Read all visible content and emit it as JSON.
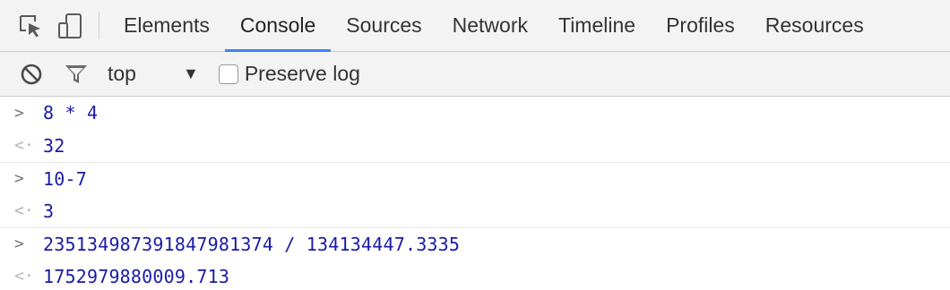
{
  "tabs": [
    {
      "label": "Elements"
    },
    {
      "label": "Console",
      "active": true
    },
    {
      "label": "Sources"
    },
    {
      "label": "Network"
    },
    {
      "label": "Timeline"
    },
    {
      "label": "Profiles"
    },
    {
      "label": "Resources"
    }
  ],
  "tools": {
    "inspect_icon": "cursor-select-icon",
    "device_icon": "device-mode-icon"
  },
  "toolbar": {
    "clear_icon": "clear-console-icon",
    "filter_icon": "filter-icon",
    "context_value": "top",
    "context_arrow": "▼",
    "preserve_log_label": "Preserve log",
    "preserve_log_checked": false
  },
  "console": {
    "prompt_symbol": ">",
    "result_symbol": "<·",
    "entries": [
      {
        "input": "8 * 4",
        "output": "32"
      },
      {
        "input": "10-7",
        "output": "3"
      },
      {
        "input": "23513498739184798137​4 / 134134447.3335",
        "output": "1752979880009.713"
      }
    ]
  },
  "colors": {
    "accent": "#3e82f7",
    "value_blue": "#1a1aa6",
    "toolbar_bg": "#f3f3f3"
  }
}
